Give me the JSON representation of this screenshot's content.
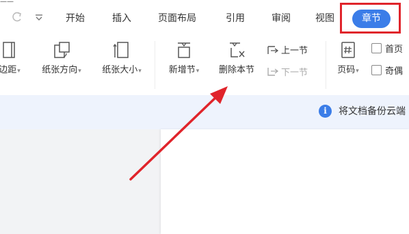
{
  "top_cut_text": "——",
  "quick_access": {
    "redo_icon": "redo-icon",
    "dropdown_icon": "quick-access-dropdown-icon"
  },
  "tabs": [
    {
      "label": "开始"
    },
    {
      "label": "插入"
    },
    {
      "label": "页面布局"
    },
    {
      "label": "引用"
    },
    {
      "label": "审阅"
    },
    {
      "label": "视图"
    },
    {
      "label": "章节",
      "active": true
    }
  ],
  "ribbon": {
    "margins_label": "边距",
    "orientation_label": "纸张方向",
    "size_label": "纸张大小",
    "new_section_label": "新增节",
    "delete_section_label": "删除本节",
    "prev_section_label": "上一节",
    "next_section_label": "下一节",
    "page_number_label": "页码",
    "first_page_label": "首页",
    "odd_even_label": "奇偶"
  },
  "infobar": {
    "icon": "info-icon",
    "text": "将文档备份云端"
  },
  "colors": {
    "accent": "#3b7de8",
    "highlight_border": "#e0242b",
    "arrow": "#e0242b",
    "infobar_bg": "#eef3fd"
  }
}
